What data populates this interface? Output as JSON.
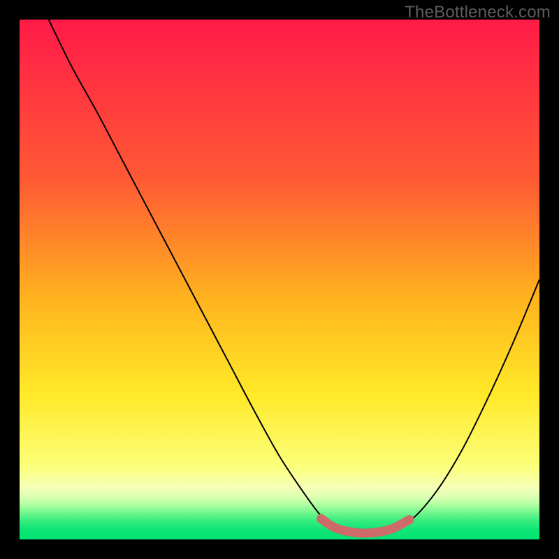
{
  "watermark": "TheBottleneck.com",
  "colors": {
    "gradient_top": "#ff1a48",
    "gradient_mid1": "#ff6a2e",
    "gradient_mid2": "#ffc81e",
    "gradient_mid3": "#fff35a",
    "gradient_mid4": "#f7ffa8",
    "gradient_bottom": "#00e472",
    "curve": "#000000",
    "marker": "#cf6a6a",
    "frame": "#000000"
  },
  "chart_data": {
    "type": "line",
    "title": "",
    "xlabel": "",
    "ylabel": "",
    "xlim": [
      0,
      100
    ],
    "ylim": [
      0,
      100
    ],
    "series": [
      {
        "name": "bottleneck-curve",
        "x": [
          5.6,
          10,
          15,
          20,
          25,
          30,
          35,
          40,
          45,
          50,
          55,
          58,
          60,
          63,
          66,
          70,
          75,
          80,
          85,
          90,
          95,
          100
        ],
        "y": [
          100,
          91,
          82,
          72.5,
          63,
          53.5,
          44,
          34.5,
          25,
          16,
          8.5,
          4.5,
          2.5,
          1.4,
          1.2,
          1.4,
          3.5,
          9,
          17,
          27,
          38,
          50
        ]
      }
    ],
    "markers": {
      "name": "highlight-band",
      "x": [
        58,
        60,
        62,
        64,
        66,
        68,
        70,
        72,
        75
      ],
      "y": [
        4.0,
        2.6,
        1.8,
        1.4,
        1.2,
        1.3,
        1.6,
        2.2,
        3.8
      ]
    },
    "gradient_stops_pct": [
      0,
      31,
      54,
      72,
      86,
      90,
      92,
      93.5,
      95,
      96.5,
      98,
      100
    ]
  }
}
